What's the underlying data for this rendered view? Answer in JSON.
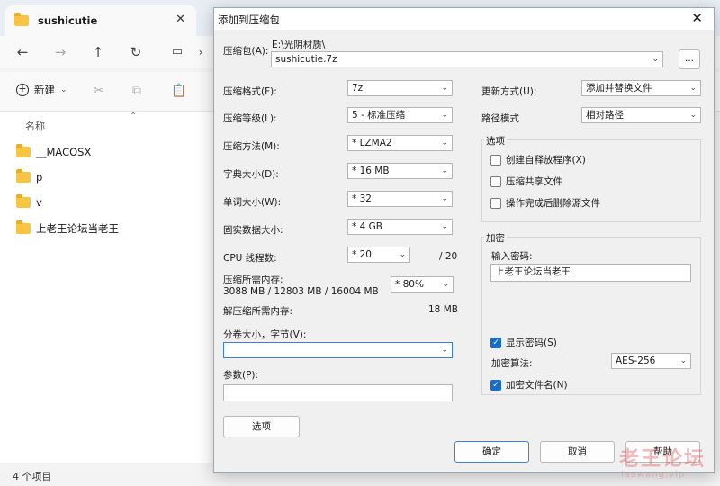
{
  "explorer": {
    "tab_title": "sushicutie",
    "tab_close": "✕",
    "new_label": "新建",
    "column_name": "名称",
    "files": [
      "__MACOSX",
      "p",
      "v",
      "上老王论坛当老王"
    ],
    "status": "4 个项目"
  },
  "dialog": {
    "title": "添加到压缩包",
    "close": "✕",
    "archive_label": "压缩包(A):",
    "archive_path": "E:\\光阴材质\\",
    "archive_name": "sushicutie.7z",
    "browse": "...",
    "format_label": "压缩格式(F):",
    "format_value": "7z",
    "level_label": "压缩等级(L):",
    "level_value": "5 - 标准压缩",
    "method_label": "压缩方法(M):",
    "method_value": "* LZMA2",
    "dict_label": "字典大小(D):",
    "dict_value": "* 16 MB",
    "word_label": "单词大小(W):",
    "word_value": "* 32",
    "solid_label": "固实数据大小:",
    "solid_value": "* 4 GB",
    "cpu_label": "CPU 线程数:",
    "cpu_value": "* 20",
    "cpu_total": "/ 20",
    "mem_comp_label": "压缩所需内存:",
    "mem_comp_value": "3088 MB / 12803 MB / 16004 MB",
    "mem_percent": "* 80%",
    "mem_decomp_label": "解压缩所需内存:",
    "mem_decomp_value": "18 MB",
    "split_label": "分卷大小，字节(V):",
    "split_value": "",
    "params_label": "参数(P):",
    "params_value": "",
    "options_btn": "选项",
    "update_label": "更新方式(U):",
    "update_value": "添加并替换文件",
    "path_label": "路径模式",
    "path_value": "相对路径",
    "options_group": "选项",
    "opt_sfx": "创建自释放程序(X)",
    "opt_shared": "压缩共享文件",
    "opt_delete": "操作完成后删除源文件",
    "encrypt_group": "加密",
    "password_label": "输入密码:",
    "password_value": "上老王论坛当老王",
    "show_password": "显示密码(S)",
    "enc_method_label": "加密算法:",
    "enc_method_value": "AES-256",
    "encrypt_names": "加密文件名(N)",
    "ok": "确定",
    "cancel": "取消",
    "help": "帮助"
  },
  "watermark": {
    "text": "老王论坛",
    "sub": "laowang.vip"
  }
}
